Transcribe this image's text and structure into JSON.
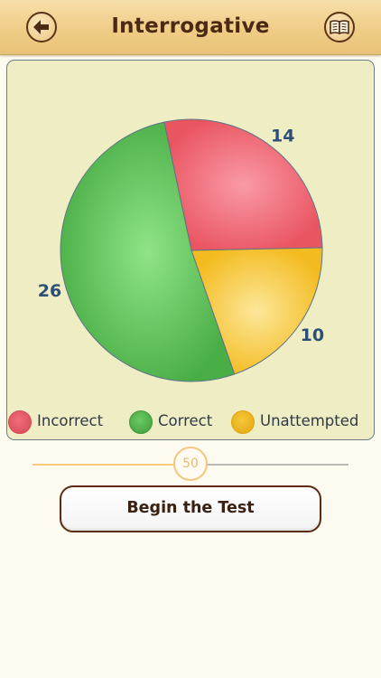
{
  "header": {
    "title": "Interrogative",
    "back_icon": "back-arrow-icon",
    "book_icon": "book-icon"
  },
  "chart_data": {
    "type": "pie",
    "slices": [
      {
        "label": "Incorrect",
        "value": 14,
        "color": "#f06e7a"
      },
      {
        "label": "Unattempted",
        "value": 10,
        "color": "#f6c83a"
      },
      {
        "label": "Correct",
        "value": 26,
        "color": "#6ccb62"
      }
    ],
    "legend": [
      "Incorrect",
      "Correct",
      "Unattempted"
    ],
    "legend_colors": [
      "#f06e7a",
      "#6ccb62",
      "#f6c83a"
    ]
  },
  "slider": {
    "value": "50",
    "fraction": 0.5
  },
  "actions": {
    "begin_label": "Begin the Test"
  },
  "colors": {
    "header_bg": "#f0cc86",
    "card_bg": "#eeedc4",
    "accent": "#f2c77d",
    "label_color": "#2e4f75"
  }
}
